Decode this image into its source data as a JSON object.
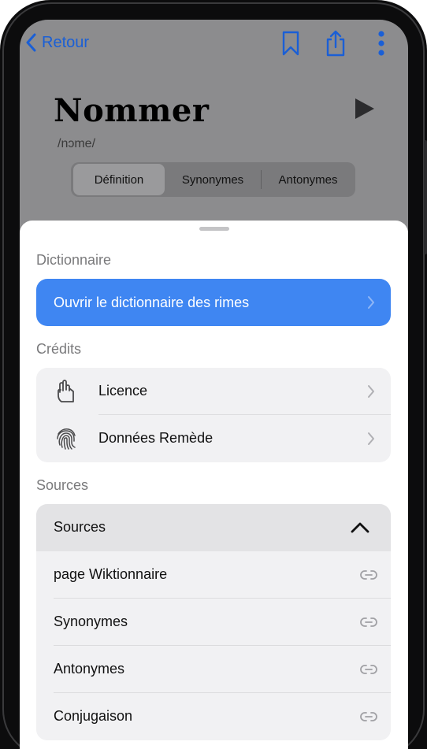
{
  "topbar": {
    "back_label": "Retour",
    "icons": [
      "chevron-left-icon",
      "bookmark-icon",
      "share-icon",
      "more-vertical-icon"
    ]
  },
  "word": {
    "title": "Nommer",
    "phonetic": "/nɔme/"
  },
  "segments": [
    {
      "label": "Définition",
      "active": true
    },
    {
      "label": "Synonymes",
      "active": false
    },
    {
      "label": "Antonymes",
      "active": false
    }
  ],
  "sheet": {
    "dictionary_header": "Dictionnaire",
    "rhymes_button": "Ouvrir le dictionnaire des rimes",
    "credits_header": "Crédits",
    "credits": [
      {
        "label": "Licence",
        "icon": "hand-icon"
      },
      {
        "label": "Données Remède",
        "icon": "fingerprint-icon"
      }
    ],
    "sources_header": "Sources",
    "sources_group_title": "Sources",
    "sources": [
      {
        "label": "page Wiktionnaire",
        "icon": "link-icon"
      },
      {
        "label": "Synonymes",
        "icon": "link-icon"
      },
      {
        "label": "Antonymes",
        "icon": "link-icon"
      },
      {
        "label": "Conjugaison",
        "icon": "link-icon"
      }
    ]
  },
  "colors": {
    "accent": "#3f86f2",
    "link_blue": "#1a5fd6",
    "dim_background": "#8c8c8e"
  }
}
